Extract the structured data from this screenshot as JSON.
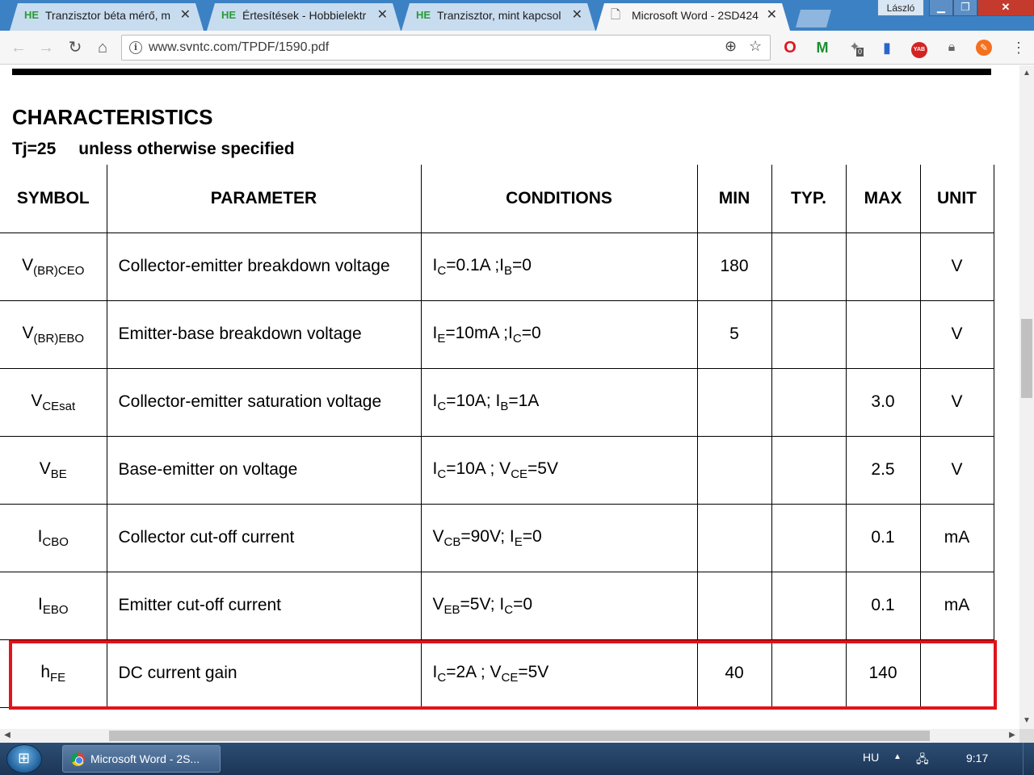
{
  "browser": {
    "tabs": [
      {
        "favicon": "HE",
        "title": "Tranzisztor béta mérő, m",
        "active": false
      },
      {
        "favicon": "HE",
        "title": "Értesítések - Hobbielektr",
        "active": false
      },
      {
        "favicon": "HE",
        "title": "Tranzisztor, mint kapcsol",
        "active": false
      },
      {
        "favicon": "doc-icon",
        "title": "Microsoft Word - 2SD424",
        "active": true
      }
    ],
    "tab_close_glyph": "✕",
    "profile_name": "László",
    "window_buttons": {
      "minimize": "▁",
      "maximize": "❐",
      "close": "✕"
    },
    "url": "www.svntc.com/TPDF/1590.pdf",
    "extension_badge": "0",
    "extensions": [
      "opera-icon",
      "gmail-icon",
      "puzzle-icon",
      "bookmark-icon",
      "yab-icon",
      "bag-icon",
      "firefox-icon"
    ],
    "extension_yab_label": "YAB"
  },
  "document": {
    "heading": "CHARACTERISTICS",
    "subheading_cond": "Tj=25",
    "subheading_text": "unless otherwise specified",
    "columns": [
      "SYMBOL",
      "PARAMETER",
      "CONDITIONS",
      "MIN",
      "TYP.",
      "MAX",
      "UNIT"
    ],
    "rows": [
      {
        "symbol": "V",
        "symbol_sub": "(BR)CEO",
        "parameter": "Collector-emitter breakdown voltage",
        "conditions": [
          [
            "I",
            "C",
            "=0.1A ;"
          ],
          [
            "I",
            "B",
            "=0"
          ]
        ],
        "min": "180",
        "typ": "",
        "max": "",
        "unit": "V"
      },
      {
        "symbol": "V",
        "symbol_sub": "(BR)EBO",
        "parameter": "Emitter-base breakdown voltage",
        "conditions": [
          [
            "I",
            "E",
            "=10mA ;"
          ],
          [
            "I",
            "C",
            "=0"
          ]
        ],
        "min": "5",
        "typ": "",
        "max": "",
        "unit": "V"
      },
      {
        "symbol": "V",
        "symbol_sub": "CEsat",
        "parameter": "Collector-emitter saturation voltage",
        "conditions": [
          [
            "I",
            "C",
            "=10A; "
          ],
          [
            "I",
            "B",
            "=1A"
          ]
        ],
        "min": "",
        "typ": "",
        "max": "3.0",
        "unit": "V"
      },
      {
        "symbol": "V",
        "symbol_sub": "BE",
        "parameter": "Base-emitter on voltage",
        "conditions": [
          [
            "I",
            "C",
            "=10A ; "
          ],
          [
            "V",
            "CE",
            "=5V"
          ]
        ],
        "min": "",
        "typ": "",
        "max": "2.5",
        "unit": "V"
      },
      {
        "symbol": "I",
        "symbol_sub": "CBO",
        "parameter": "Collector cut-off current",
        "conditions": [
          [
            "V",
            "CB",
            "=90V; "
          ],
          [
            "I",
            "E",
            "=0"
          ]
        ],
        "min": "",
        "typ": "",
        "max": "0.1",
        "unit": "mA"
      },
      {
        "symbol": "I",
        "symbol_sub": "EBO",
        "parameter": "Emitter cut-off current",
        "conditions": [
          [
            "V",
            "EB",
            "=5V; "
          ],
          [
            "I",
            "C",
            "=0"
          ]
        ],
        "min": "",
        "typ": "",
        "max": "0.1",
        "unit": "mA"
      },
      {
        "symbol": "h",
        "symbol_sub": "FE",
        "parameter": "DC current gain",
        "conditions": [
          [
            "I",
            "C",
            "=2A ; "
          ],
          [
            "V",
            "CE",
            "=5V"
          ]
        ],
        "min": "40",
        "typ": "",
        "max": "140",
        "unit": ""
      }
    ],
    "highlight_color": "#e0141b"
  },
  "taskbar": {
    "task_label": "Microsoft Word - 2S...",
    "language": "HU",
    "clock": "9:17"
  }
}
